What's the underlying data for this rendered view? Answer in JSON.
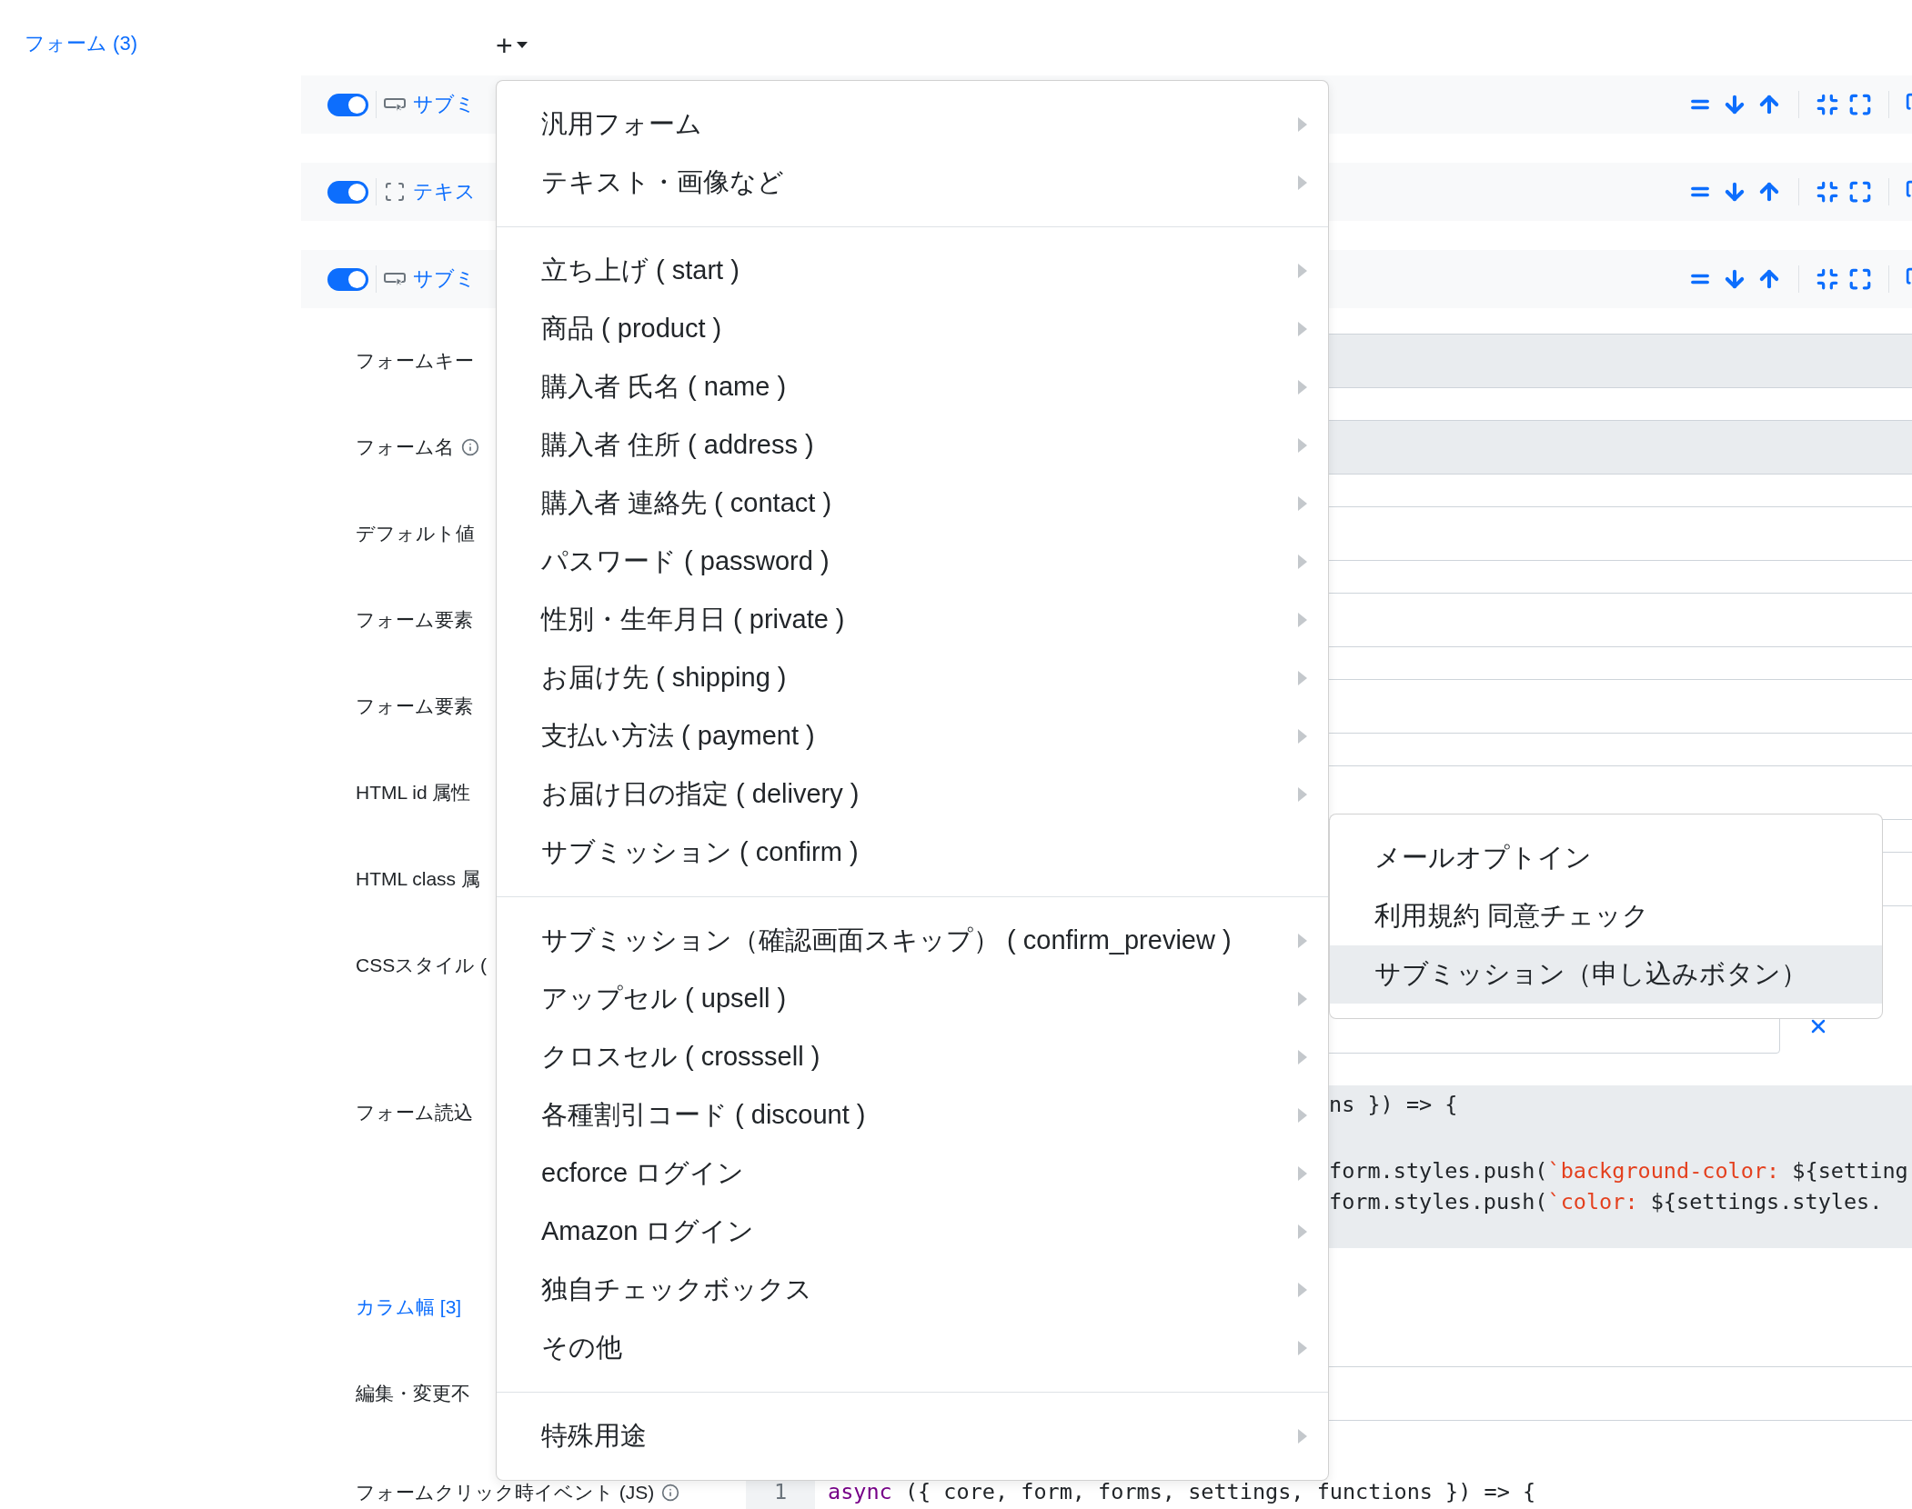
{
  "sidebar": {
    "title": "フォーム (3)"
  },
  "toolbar": {
    "add_label": "+"
  },
  "form_rows": [
    {
      "enabled": true,
      "kind": "submit",
      "title": "サブミ"
    },
    {
      "enabled": true,
      "kind": "text",
      "title": "テキス"
    },
    {
      "enabled": true,
      "kind": "submit",
      "title": "サブミ"
    }
  ],
  "fields": [
    {
      "label": "フォームキー",
      "kind": "input",
      "disabled": true
    },
    {
      "label": "フォーム名",
      "kind": "input",
      "disabled": true,
      "info": true
    },
    {
      "label": "デフォルト値",
      "kind": "input",
      "disabled": false
    },
    {
      "label": "フォーム要素",
      "kind": "input",
      "disabled": false
    },
    {
      "label": "フォーム要素",
      "kind": "input",
      "disabled": false
    },
    {
      "label": "HTML id 属性",
      "kind": "input",
      "disabled": false
    },
    {
      "label": "HTML class 属",
      "kind": "input",
      "disabled": false
    },
    {
      "label": "CSSスタイル (",
      "kind": "textarea"
    },
    {
      "label": "フォーム読込",
      "kind": "code",
      "lines": [
        {
          "segments": [
            {
              "text": "ns }) => {",
              "kind": "plain"
            }
          ]
        },
        {
          "segments": [
            {
              "text": "form.styles.push(",
              "kind": "plain"
            },
            {
              "text": "`background-color: ",
              "kind": "string"
            },
            {
              "text": "${setting",
              "kind": "plain"
            }
          ]
        },
        {
          "segments": [
            {
              "text": "form.styles.push(",
              "kind": "plain"
            },
            {
              "text": "`color: ",
              "kind": "string"
            },
            {
              "text": "${settings.styles.",
              "kind": "plain"
            }
          ]
        }
      ]
    },
    {
      "label": "カラム幅 [3]",
      "kind": "link"
    },
    {
      "label": "編集・変更不",
      "kind": "input",
      "disabled": false
    },
    {
      "label": "フォームクリック時イベント (JS)",
      "kind": "code_gutter",
      "info": true,
      "lines": [
        {
          "number": "1",
          "segments": [
            {
              "text": "async",
              "kind": "keyword"
            },
            {
              "text": " ({ core, form, forms, settings, functions }) => {",
              "kind": "plain"
            }
          ]
        }
      ]
    }
  ],
  "menu": {
    "sections": [
      {
        "items": [
          {
            "label": "汎用フォーム",
            "arrow": true
          },
          {
            "label": "テキスト・画像など",
            "arrow": true
          }
        ]
      },
      {
        "items": [
          {
            "label": "立ち上げ ( start )",
            "arrow": true
          },
          {
            "label": "商品 ( product )",
            "arrow": true
          },
          {
            "label": "購入者 氏名 ( name )",
            "arrow": true
          },
          {
            "label": "購入者 住所 ( address )",
            "arrow": true
          },
          {
            "label": "購入者 連絡先 ( contact )",
            "arrow": true
          },
          {
            "label": "パスワード ( password )",
            "arrow": true
          },
          {
            "label": "性別・生年月日 ( private )",
            "arrow": true
          },
          {
            "label": "お届け先 ( shipping )",
            "arrow": true
          },
          {
            "label": "支払い方法 ( payment )",
            "arrow": true
          },
          {
            "label": "お届け日の指定 ( delivery )",
            "arrow": true
          },
          {
            "label": "サブミッション ( confirm )",
            "arrow": false
          }
        ]
      },
      {
        "items": [
          {
            "label": "サブミッション（確認画面スキップ） ( confirm_preview )",
            "arrow": true
          },
          {
            "label": "アップセル ( upsell )",
            "arrow": true
          },
          {
            "label": "クロスセル ( crosssell )",
            "arrow": true
          },
          {
            "label": "各種割引コード ( discount )",
            "arrow": true
          },
          {
            "label": "ecforce ログイン",
            "arrow": true
          },
          {
            "label": "Amazon ログイン",
            "arrow": true
          },
          {
            "label": "独自チェックボックス",
            "arrow": true
          },
          {
            "label": "その他",
            "arrow": true
          }
        ]
      },
      {
        "items": [
          {
            "label": "特殊用途",
            "arrow": true
          }
        ]
      }
    ]
  },
  "submenu": {
    "items": [
      {
        "label": "メールオプトイン",
        "selected": false
      },
      {
        "label": "利用規約 同意チェック",
        "selected": false
      },
      {
        "label": "サブミッション（申し込みボタン）",
        "selected": true
      }
    ]
  }
}
